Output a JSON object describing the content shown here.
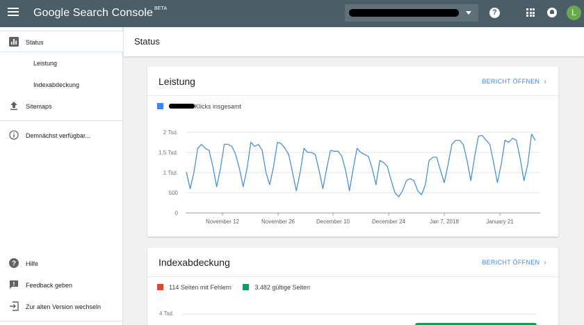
{
  "header": {
    "app_title": "Google Search Console",
    "app_badge": "BETA",
    "avatar_initial": "L"
  },
  "sidebar": {
    "items": [
      {
        "label": "Status"
      },
      {
        "label": "Leistung"
      },
      {
        "label": "Indexabdeckung"
      },
      {
        "label": "Sitemaps"
      },
      {
        "label": "Demnächst verfügbar..."
      },
      {
        "label": "Hilfe"
      },
      {
        "label": "Feedback geben"
      },
      {
        "label": "Zur alten Version wechseln"
      }
    ]
  },
  "page": {
    "title": "Status"
  },
  "performance_card": {
    "title": "Leistung",
    "link": "BERICHT ÖFFNEN",
    "legend": "Klicks insgesamt",
    "legend_color": "#4285f4"
  },
  "coverage_card": {
    "title": "Indexabdeckung",
    "link": "BERICHT ÖFFNEN",
    "legend_errors": "114 Seiten mit Fehlern",
    "legend_errors_color": "#db4437",
    "legend_valid": "3.482 gültige Seiten",
    "legend_valid_color": "#0f9d58",
    "y_tick": "4 Tsd."
  },
  "chart_data": {
    "type": "line",
    "series": [
      {
        "color": "#4a90d9",
        "values": [
          1020,
          600,
          1000,
          1600,
          1700,
          1600,
          1550,
          1150,
          650,
          1100,
          1700,
          1700,
          1650,
          1450,
          1100,
          650,
          1100,
          1750,
          1650,
          1700,
          1550,
          1000,
          700,
          1150,
          1750,
          1720,
          1600,
          1450,
          1000,
          550,
          1000,
          1600,
          1500,
          1500,
          1450,
          1050,
          600,
          1100,
          1550,
          1530,
          1530,
          1400,
          1050,
          550,
          1100,
          1600,
          1500,
          1450,
          1400,
          1100,
          700,
          1300,
          1250,
          1150,
          800,
          500,
          400,
          550,
          800,
          850,
          800,
          550,
          450,
          700,
          1300,
          1380,
          1380,
          1050,
          750,
          1200,
          1700,
          1800,
          1800,
          1700,
          1300,
          800,
          1400,
          1900,
          1920,
          1800,
          1700,
          1250,
          750,
          1200,
          1800,
          1750,
          1850,
          1800,
          1350,
          800,
          1200,
          1950,
          1800
        ]
      }
    ],
    "x_ticks": [
      "November 12",
      "November 26",
      "December 10",
      "December 24",
      "Jan 7, 2018",
      "January 21"
    ],
    "y_ticks": [
      "0",
      "500",
      "1 Tsd.",
      "1,5 Tsd.",
      "2 Tsd."
    ],
    "ylim": [
      0,
      2000
    ]
  }
}
